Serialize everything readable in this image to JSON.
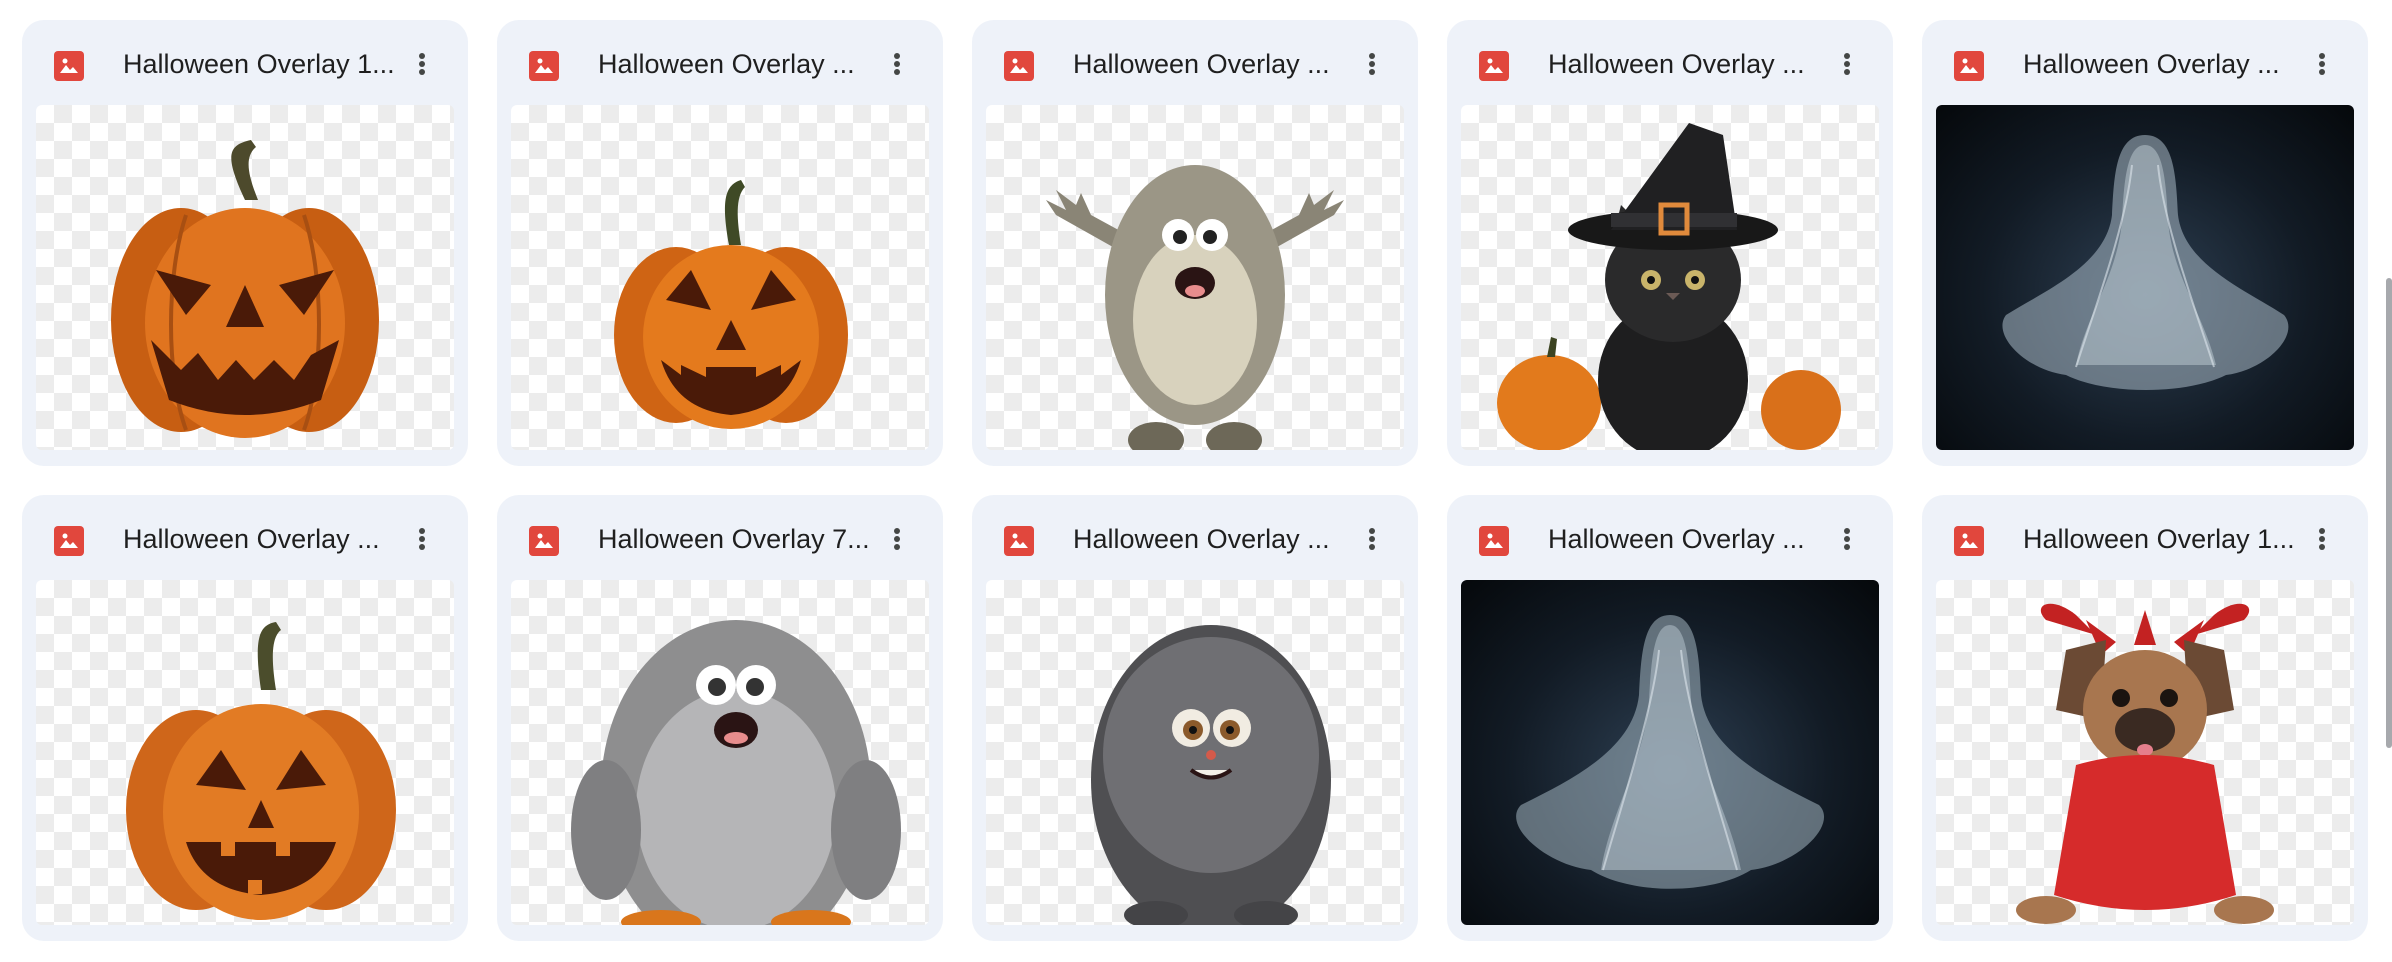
{
  "files": [
    {
      "title": "Halloween Overlay 1...",
      "type_icon": "image-file-icon",
      "thumbnail": "jack-o-lantern-pumpkin",
      "bg": "transparent"
    },
    {
      "title": "Halloween Overlay ...",
      "type_icon": "image-file-icon",
      "thumbnail": "jack-o-lantern-pumpkin",
      "bg": "transparent"
    },
    {
      "title": "Halloween Overlay ...",
      "type_icon": "image-file-icon",
      "thumbnail": "fuzzy-monster",
      "bg": "transparent"
    },
    {
      "title": "Halloween Overlay ...",
      "type_icon": "image-file-icon",
      "thumbnail": "black-cat-witch-hat",
      "bg": "transparent"
    },
    {
      "title": "Halloween Overlay ...",
      "type_icon": "image-file-icon",
      "thumbnail": "ghost-sheet",
      "bg": "dark"
    },
    {
      "title": "Halloween Overlay ...",
      "type_icon": "image-file-icon",
      "thumbnail": "jack-o-lantern-pumpkin",
      "bg": "transparent"
    },
    {
      "title": "Halloween Overlay 7...",
      "type_icon": "image-file-icon",
      "thumbnail": "fuzzy-monster",
      "bg": "transparent"
    },
    {
      "title": "Halloween Overlay ...",
      "type_icon": "image-file-icon",
      "thumbnail": "fuzzy-monster",
      "bg": "transparent"
    },
    {
      "title": "Halloween Overlay ...",
      "type_icon": "image-file-icon",
      "thumbnail": "ghost-sheet",
      "bg": "dark"
    },
    {
      "title": "Halloween Overlay 1...",
      "type_icon": "image-file-icon",
      "thumbnail": "devil-bulldog",
      "bg": "transparent"
    }
  ],
  "more_icon": "more-vert-icon",
  "colors": {
    "card_bg": "#eef2f9",
    "file_icon": "#e1473d",
    "title_text": "#1f1f1f",
    "pumpkin": "#e0741f",
    "devil_red": "#d62b2b"
  }
}
